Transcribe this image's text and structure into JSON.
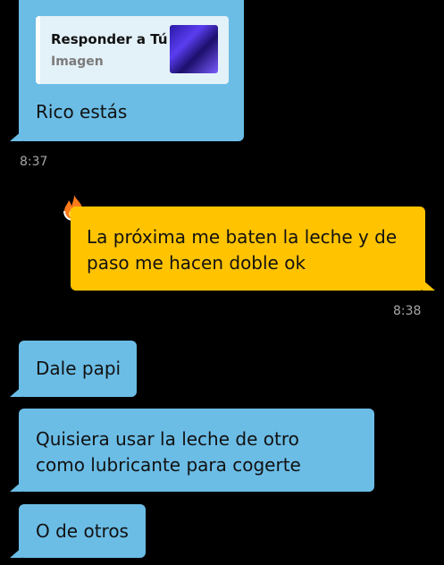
{
  "messages": [
    {
      "id": "m1",
      "direction": "incoming",
      "reply_preview": {
        "title": "Responder a Tú",
        "subtitle": "Imagen"
      },
      "text": "Rico estás",
      "time": "8:37"
    },
    {
      "id": "m2",
      "direction": "outgoing",
      "icon": "flame-icon",
      "lines": [
        "La próxima me baten la leche y de",
        "paso me hacen doble ok"
      ],
      "time": "8:38"
    },
    {
      "id": "m3",
      "direction": "incoming",
      "text": "Dale papi"
    },
    {
      "id": "m4",
      "direction": "incoming",
      "lines": [
        "Quisiera usar la leche de otro",
        "como lubricante para cogerte"
      ]
    },
    {
      "id": "m5",
      "direction": "incoming",
      "text": "O de otros"
    }
  ],
  "colors": {
    "background": "#000000",
    "incoming_bubble": "#6bbde6",
    "outgoing_bubble": "#ffc300",
    "timestamp": "#a6a6a6"
  }
}
